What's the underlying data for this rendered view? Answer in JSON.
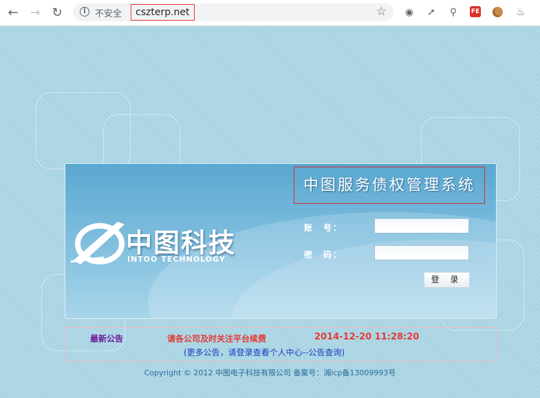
{
  "browser": {
    "security_label": "不安全",
    "url": "cszterp.net",
    "fe_label": "FE"
  },
  "login": {
    "system_title": "中图服务债权管理系统",
    "logo_cn": "中图科技",
    "logo_en": "INTOO TECHNOLOGY",
    "account_label": "账　号：",
    "password_label": "密　码：",
    "account_value": "",
    "password_value": "",
    "login_button": "登 录"
  },
  "notice": {
    "heading": "最新公告",
    "message": "请各公司及时关注平台续费",
    "date": "2014-12-20 11:28:20",
    "more": "(更多公告，请登录查看个人中心--公告查询)"
  },
  "footer": {
    "copyright": "Copyright © 2012 中图电子科技有限公司 备案号：湘icp备13009993号"
  },
  "colors": {
    "page_bg": "#a9d4e3",
    "accent_red": "#e53935",
    "link_blue": "#1a3fbf"
  }
}
